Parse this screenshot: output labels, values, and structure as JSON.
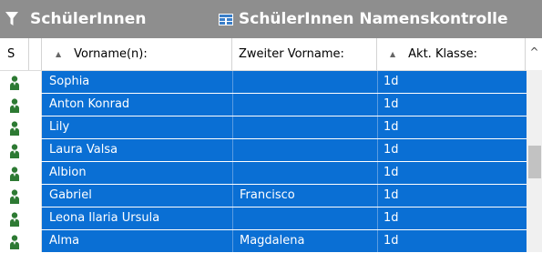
{
  "window": {
    "panel_title": "SchülerInnen",
    "tab_title": "SchülerInnen Namenskontrolle"
  },
  "header": {
    "col_s": "S",
    "col_vorname": "Vorname(n):",
    "col_zweiter": "Zweiter Vorname:",
    "col_klasse": "Akt. Klasse:"
  },
  "rows": [
    {
      "vorname": "Sophia",
      "zweiter": "",
      "klasse": "1d"
    },
    {
      "vorname": "Anton Konrad",
      "zweiter": "",
      "klasse": "1d"
    },
    {
      "vorname": "Lily",
      "zweiter": "",
      "klasse": "1d"
    },
    {
      "vorname": "Laura Valsa",
      "zweiter": "",
      "klasse": "1d"
    },
    {
      "vorname": "Albion",
      "zweiter": "",
      "klasse": "1d"
    },
    {
      "vorname": "Gabriel",
      "zweiter": "Francisco",
      "klasse": "1d"
    },
    {
      "vorname": "Leona Ilaria Ursula",
      "zweiter": "",
      "klasse": "1d"
    },
    {
      "vorname": "Alma",
      "zweiter": "Magdalena",
      "klasse": "1d"
    }
  ],
  "icons": {
    "filter": "filter-icon",
    "table": "table-icon",
    "student": "student-icon",
    "sort": "sort-ascending-icon",
    "scroll_up": "scroll-up-arrow-icon"
  },
  "colors": {
    "title_bar": "#8e8e8e",
    "selection": "#0a6fd4",
    "student_icon": "#2d7a33"
  }
}
